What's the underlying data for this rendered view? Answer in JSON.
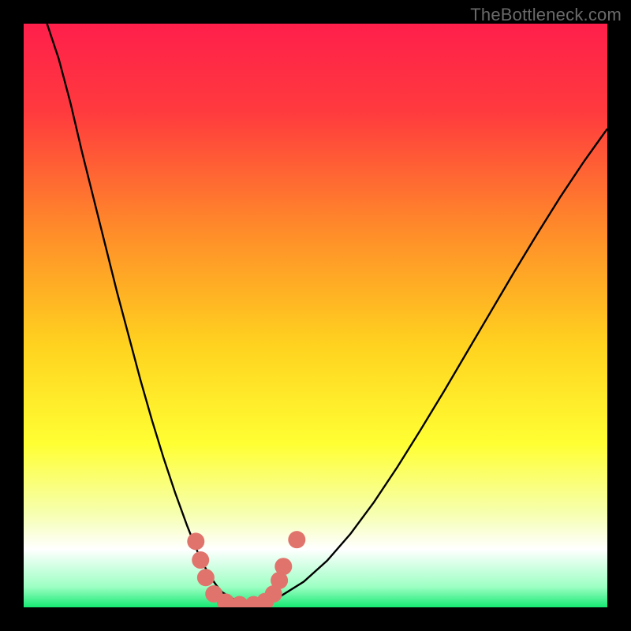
{
  "watermark": "TheBottleneck.com",
  "chart_data": {
    "type": "line",
    "title": "",
    "xlabel": "",
    "ylabel": "",
    "xlim": [
      0,
      100
    ],
    "ylim": [
      0,
      100
    ],
    "background_gradient": {
      "stops": [
        {
          "offset": 0.0,
          "color": "#ff1f4b"
        },
        {
          "offset": 0.15,
          "color": "#ff3a3e"
        },
        {
          "offset": 0.35,
          "color": "#ff8a2a"
        },
        {
          "offset": 0.55,
          "color": "#ffd21f"
        },
        {
          "offset": 0.72,
          "color": "#ffff33"
        },
        {
          "offset": 0.84,
          "color": "#f6ffb0"
        },
        {
          "offset": 0.9,
          "color": "#ffffff"
        },
        {
          "offset": 0.965,
          "color": "#9cffc3"
        },
        {
          "offset": 1.0,
          "color": "#17e973"
        }
      ]
    },
    "series": [
      {
        "name": "bottleneck-curve",
        "color": "#000000",
        "stroke_width": 2.4,
        "x": [
          4,
          6,
          8,
          10,
          12,
          14,
          16,
          18,
          20,
          22,
          24,
          26,
          28,
          30,
          31,
          32,
          33,
          34,
          36,
          38,
          40,
          44,
          48,
          52,
          56,
          60,
          64,
          68,
          72,
          76,
          80,
          84,
          88,
          92,
          96,
          100
        ],
        "y": [
          100,
          94,
          86.5,
          78,
          70,
          62,
          54,
          46.5,
          39,
          32,
          25.5,
          19.5,
          14,
          9,
          7,
          5.2,
          3.8,
          2.6,
          1.4,
          0.6,
          0.6,
          1.9,
          4.4,
          8,
          12.6,
          18,
          24,
          30.4,
          37,
          43.8,
          50.6,
          57.4,
          64,
          70.4,
          76.4,
          82
        ]
      }
    ],
    "markers": {
      "name": "highlight-dots",
      "color": "#e0746d",
      "radius": 11,
      "points": [
        {
          "x": 29.5,
          "y": 11.3
        },
        {
          "x": 30.3,
          "y": 8.1
        },
        {
          "x": 31.2,
          "y": 5.1
        },
        {
          "x": 32.6,
          "y": 2.3
        },
        {
          "x": 34.6,
          "y": 0.9
        },
        {
          "x": 37.0,
          "y": 0.45
        },
        {
          "x": 39.4,
          "y": 0.45
        },
        {
          "x": 41.4,
          "y": 1.0
        },
        {
          "x": 42.8,
          "y": 2.3
        },
        {
          "x": 43.8,
          "y": 4.6
        },
        {
          "x": 44.5,
          "y": 7.0
        },
        {
          "x": 46.8,
          "y": 11.6
        }
      ]
    }
  }
}
